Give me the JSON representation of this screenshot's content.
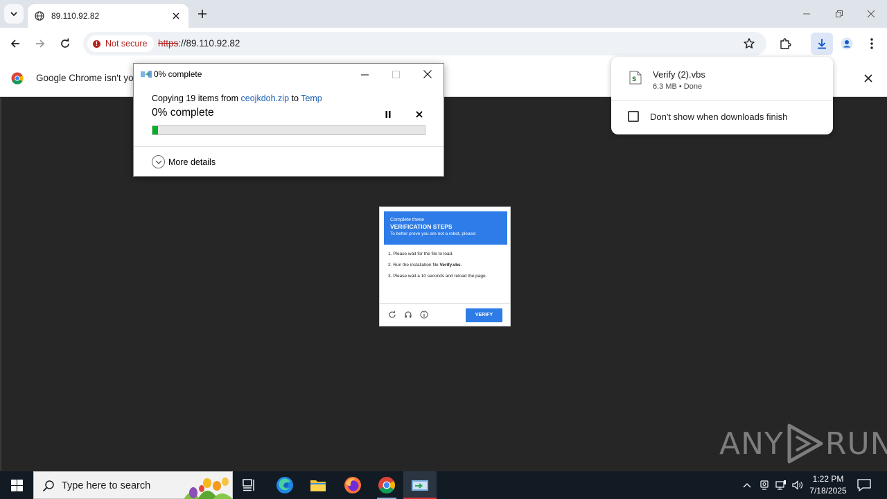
{
  "browser": {
    "tab": {
      "title": "89.110.92.82"
    },
    "security_chip": "Not secure",
    "url_scheme": "https",
    "url_rest": "://89.110.92.82",
    "infobar_message": "Google Chrome isn't you"
  },
  "copy_dialog": {
    "title": "0% complete",
    "copy_prefix": "Copying 19 items from ",
    "source": "ceojkdoh.zip",
    "to_word": " to ",
    "destination": "Temp",
    "percent_label": "0% complete",
    "progress": 0.02,
    "more_details": "More details"
  },
  "download_bubble": {
    "file_name": "Verify (2).vbs",
    "file_meta": "6.3 MB • Done",
    "checkbox_label": "Don't show when downloads finish",
    "checkbox_checked": false
  },
  "captcha": {
    "header_line1": "Complete these",
    "header_line2": "VERIFICATION STEPS",
    "header_line3": "To better prove you are not a robot, please:",
    "step1": "1. Please wait for the file to load.",
    "step2_prefix": "2. Run the installation file ",
    "step2_file": "Verify.vbs",
    "step2_suffix": ".",
    "step3": "3. Please wait a 10 seconds and reload the page.",
    "verify_label": "VERIFY",
    "accent": "#2d7ce8"
  },
  "watermark": {
    "left": "ANY",
    "right": "RUN"
  },
  "taskbar": {
    "search_placeholder": "Type here to search",
    "apps": [
      "task-view-icon",
      "edge-icon",
      "file-explorer-icon",
      "firefox-icon",
      "chrome-icon",
      "file-copy-icon"
    ],
    "time": "1:22 PM",
    "date": "7/18/2025"
  }
}
